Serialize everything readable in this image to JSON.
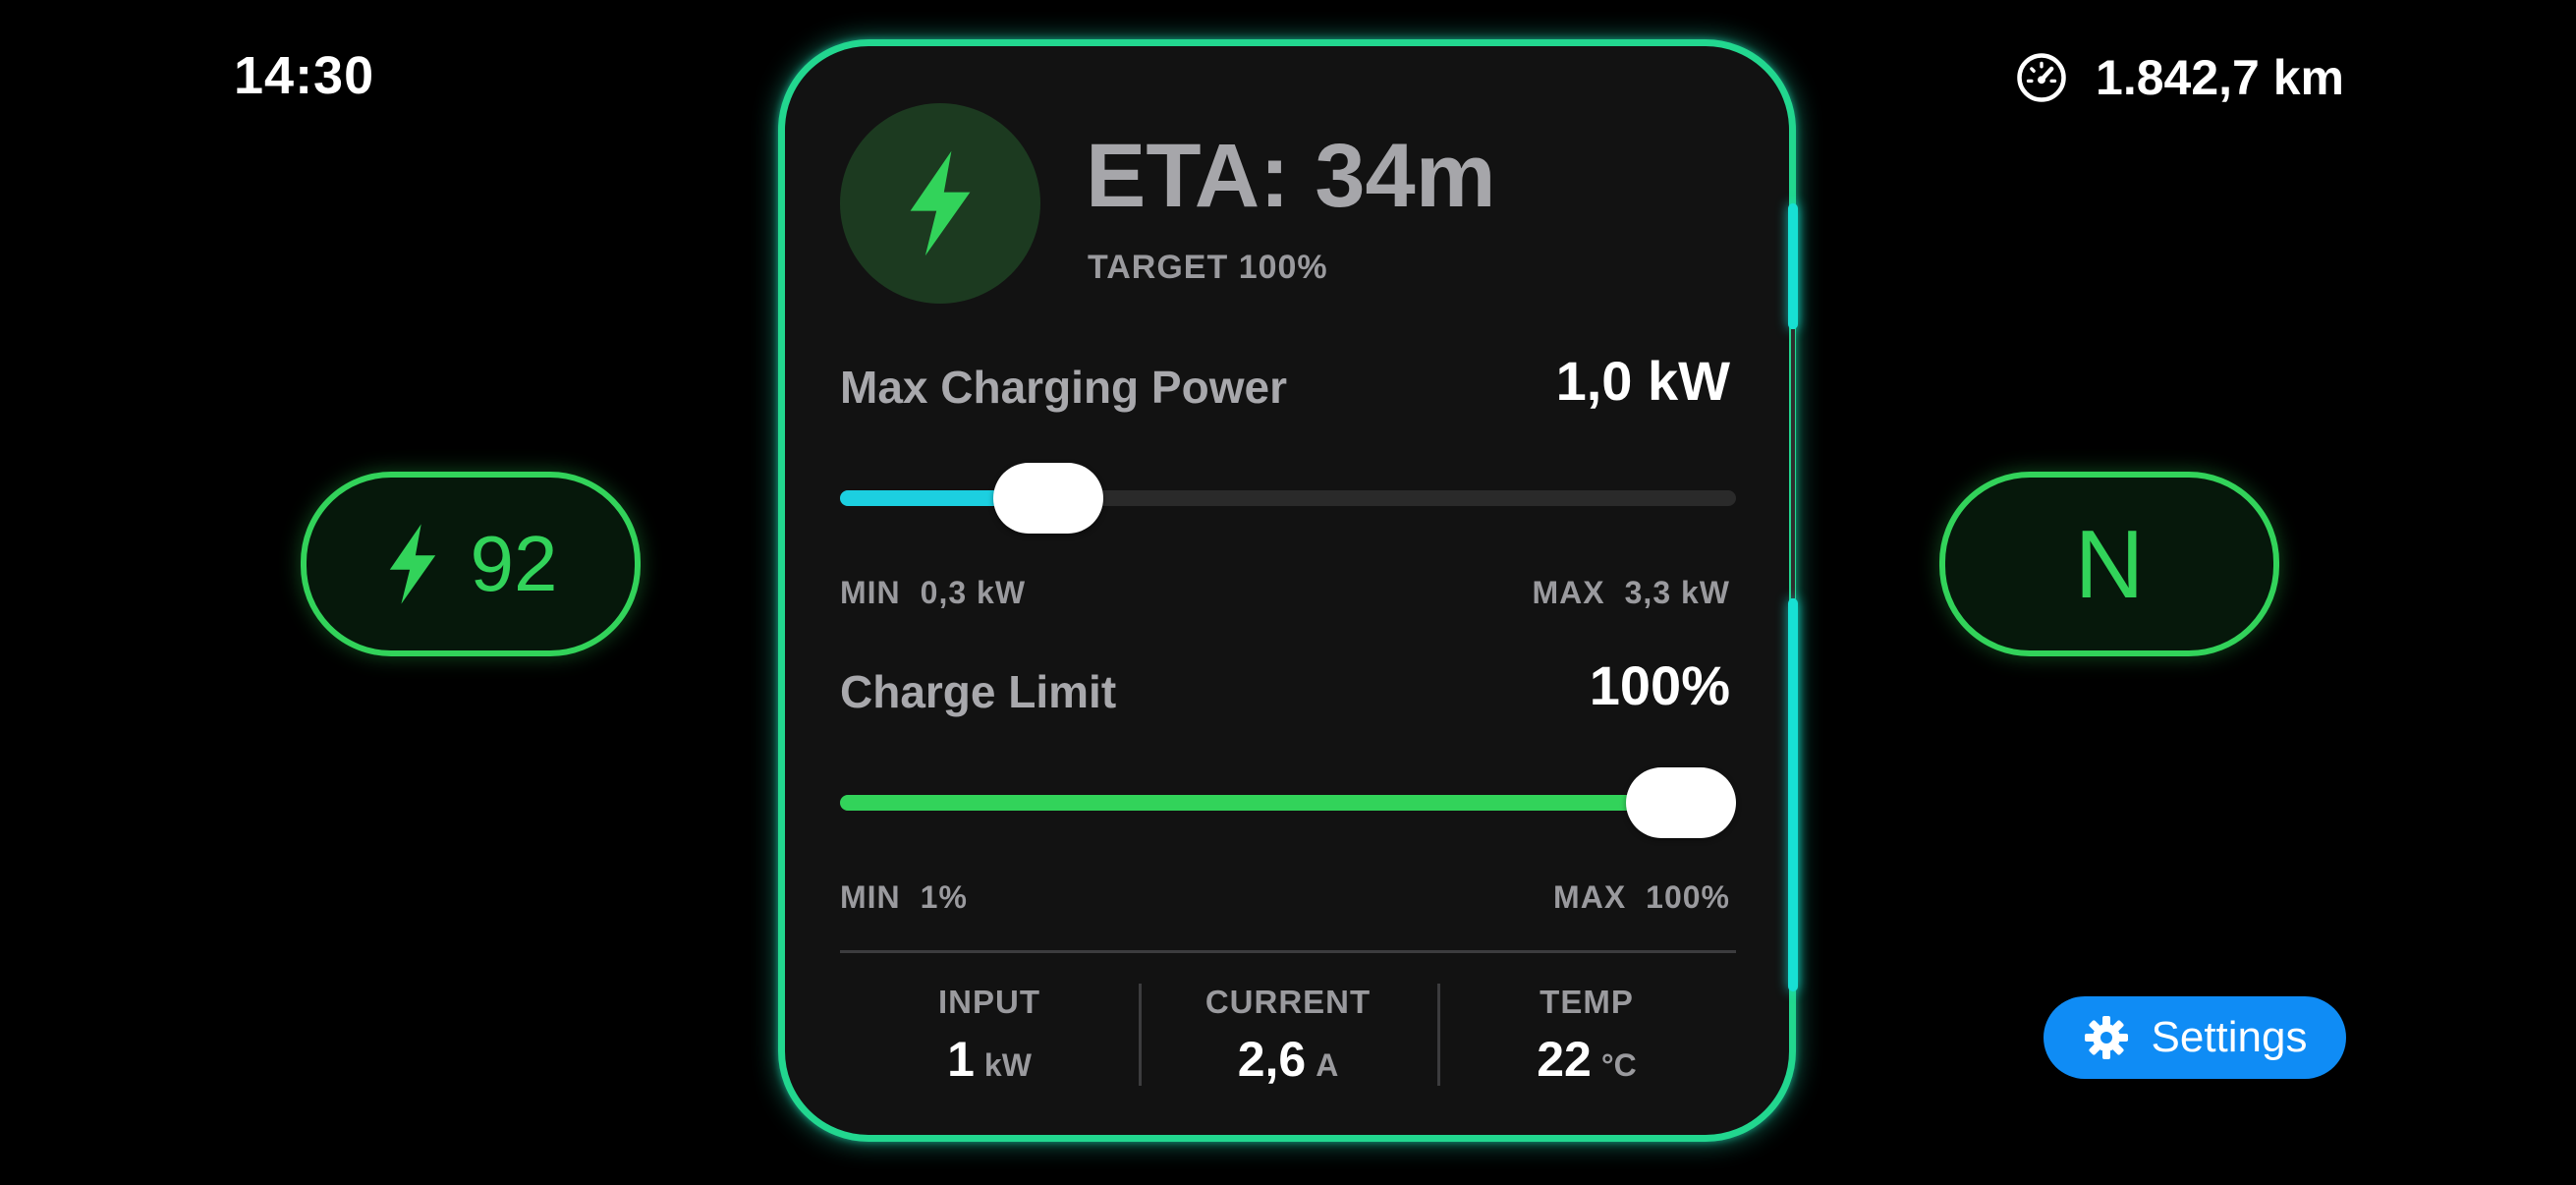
{
  "status_bar": {
    "time": "14:30",
    "odometer_icon": "speedometer-icon",
    "odometer": "1.842,7 km"
  },
  "battery": {
    "icon": "bolt-icon",
    "level": "92",
    "color": "#32d35a"
  },
  "gear": {
    "label": "N"
  },
  "panel": {
    "eta_icon": "bolt-icon",
    "eta": "ETA: 34m",
    "target": "TARGET 100%",
    "max_power": {
      "label": "Max Charging Power",
      "value": "1,0 kW",
      "min_key": "MIN",
      "min_value": "0,3 kW",
      "max_key": "MAX",
      "max_value": "3,3 kW",
      "fill_fraction": 0.233,
      "color": "#1ccfe0"
    },
    "charge_limit": {
      "label": "Charge Limit",
      "value": "100%",
      "min_key": "MIN",
      "min_value": "1%",
      "max_key": "MAX",
      "max_value": "100%",
      "fill_fraction": 1.0,
      "color": "#32d35a"
    },
    "stats": [
      {
        "label": "INPUT",
        "value": "1",
        "unit": "kW"
      },
      {
        "label": "CURRENT",
        "value": "2,6",
        "unit": "A"
      },
      {
        "label": "TEMP",
        "value": "22",
        "unit": "°C"
      }
    ],
    "border_color": "#22d78f"
  },
  "settings": {
    "icon": "gear-icon",
    "label": "Settings",
    "color": "#0f8cf5"
  }
}
